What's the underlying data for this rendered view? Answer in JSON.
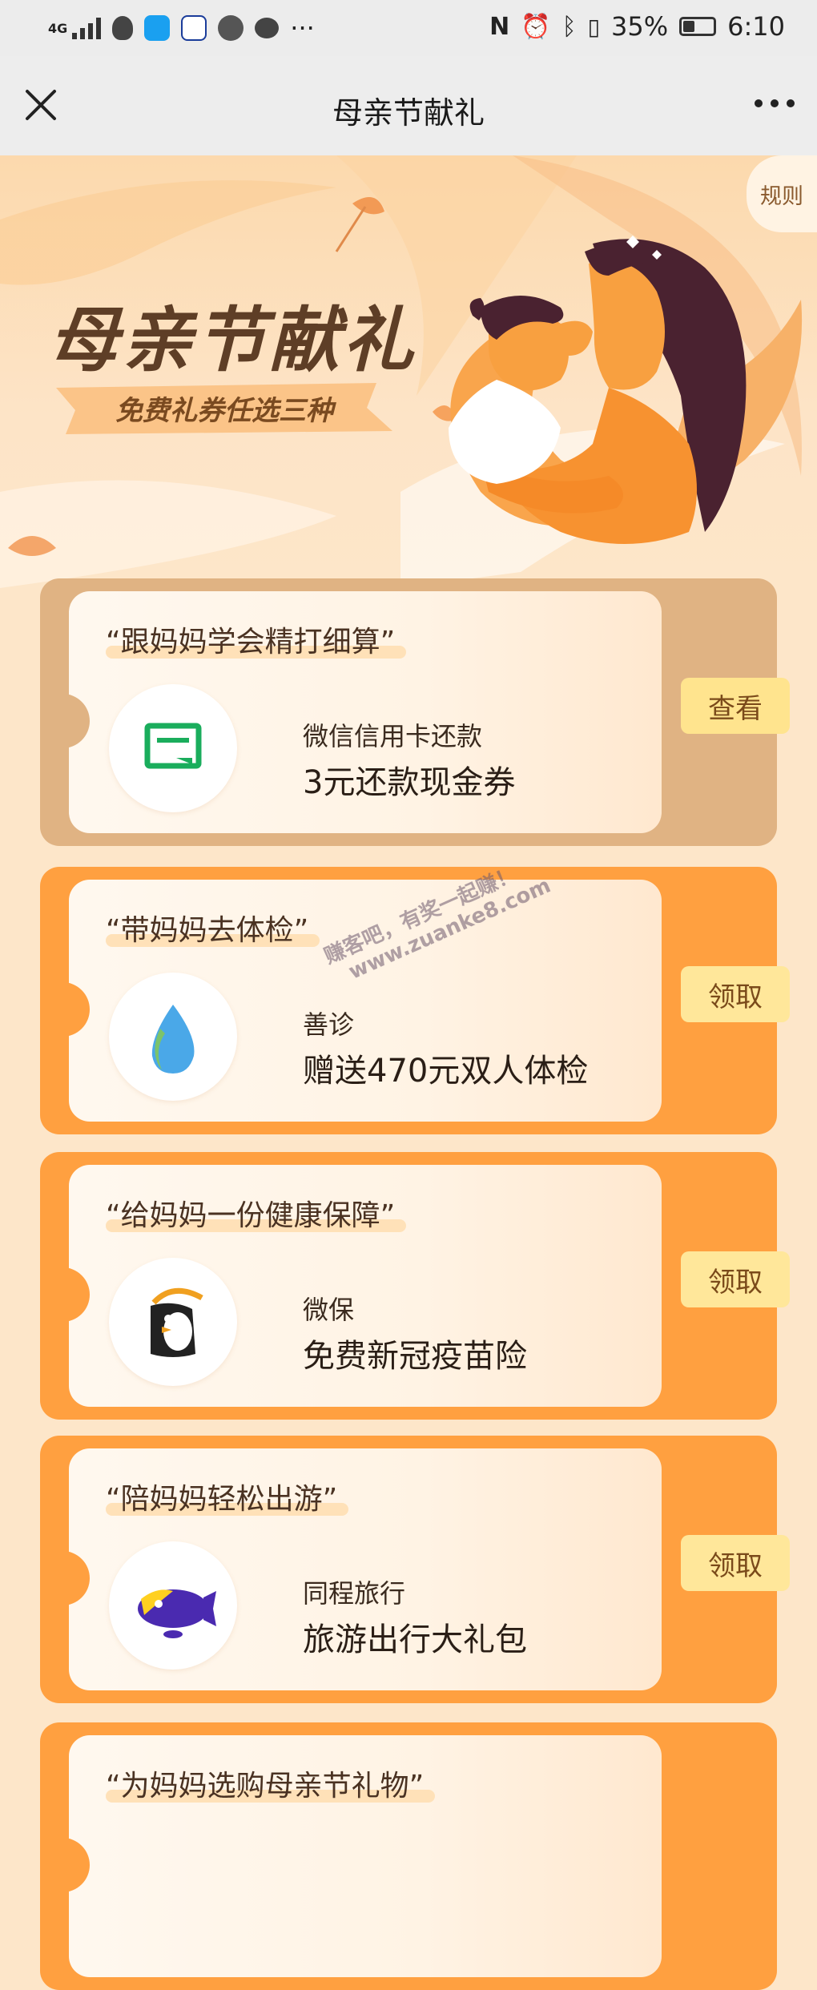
{
  "status_bar": {
    "network": "4G",
    "battery": "35%",
    "time": "6:10",
    "dots": "···"
  },
  "nav": {
    "title": "母亲节献礼"
  },
  "hero": {
    "rules_label": "规则",
    "title": "母亲节献礼",
    "subtitle": "免费礼券任选三种"
  },
  "cards": [
    {
      "quote": "“跟妈妈学会精打细算”",
      "brand": "微信信用卡还款",
      "offer": "3元还款现金券",
      "button": "查看",
      "style": "gray",
      "icon": "card-repay-icon"
    },
    {
      "quote": "“带妈妈去体检”",
      "brand": "善诊",
      "offer": "赠送470元双人体检",
      "button": "领取",
      "style": "orange",
      "icon": "water-drop-icon"
    },
    {
      "quote": "“给妈妈一份健康保障”",
      "brand": "微保",
      "offer": "免费新冠疫苗险",
      "button": "领取",
      "style": "orange",
      "icon": "penguin-icon"
    },
    {
      "quote": "“陪妈妈轻松出游”",
      "brand": "同程旅行",
      "offer": "旅游出行大礼包",
      "button": "领取",
      "style": "orange",
      "icon": "airship-icon"
    },
    {
      "quote": "“为妈妈选购母亲节礼物”"
    }
  ],
  "watermark": {
    "line1": "赚客吧，有奖一起赚！",
    "line2": "www.zuanke8.com"
  },
  "colors": {
    "page_bg": "#fde6c9",
    "card_orange": "#ffa040",
    "card_gray": "#e0b383",
    "button_bg": "#ffe79a",
    "title_brown": "#5e3e26"
  }
}
